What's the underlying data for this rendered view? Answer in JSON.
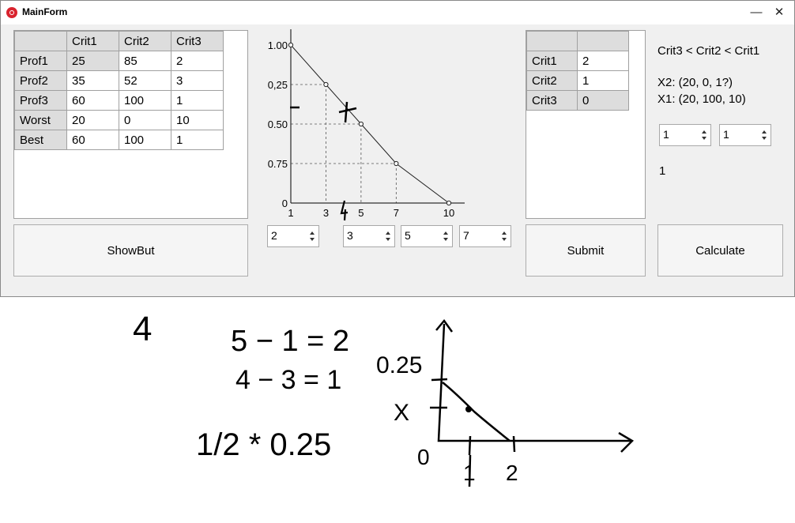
{
  "window": {
    "title": "MainForm",
    "minimize_glyph": "—",
    "close_glyph": "✕",
    "icon": "app-icon",
    "icon_color": "#d9232e"
  },
  "left_table": {
    "columns": [
      "",
      "Crit1",
      "Crit2",
      "Crit3"
    ],
    "rows": [
      [
        "Prof1",
        "25",
        "85",
        "2"
      ],
      [
        "Prof2",
        "35",
        "52",
        "3"
      ],
      [
        "Prof3",
        "60",
        "100",
        "1"
      ],
      [
        "Worst",
        "20",
        "0",
        "10"
      ],
      [
        "Best",
        "60",
        "100",
        "1"
      ]
    ]
  },
  "show_button": {
    "label": "ShowBut"
  },
  "chart_data": {
    "type": "line",
    "x": [
      1,
      3,
      5,
      7,
      10
    ],
    "y": [
      1.0,
      0.75,
      0.5,
      0.25,
      0
    ],
    "x_tick_labels": [
      "1",
      "3",
      "5",
      "7",
      "10"
    ],
    "y_tick_labels": [
      "1.00",
      "0,25",
      "0.50",
      "0.75",
      "0"
    ],
    "guide_lines": "dashed",
    "handwritten_marks": [
      "4"
    ]
  },
  "chart_spinners": [
    "2",
    "3",
    "5",
    "7"
  ],
  "right_table": {
    "rows": [
      [
        "Crit1",
        "2"
      ],
      [
        "Crit2",
        "1"
      ],
      [
        "Crit3",
        "0"
      ]
    ]
  },
  "submit_button": {
    "label": "Submit"
  },
  "results": {
    "order": "Crit3 < Crit2 < Crit1",
    "x2": "X2: (20, 0, 1?)",
    "x1": "X1: (20, 100, 10)",
    "spinner_a": "1",
    "spinner_b": "1",
    "output": "1"
  },
  "calculate_button": {
    "label": "Calculate"
  },
  "handwriting": {
    "number": "4",
    "eq1": "5 − 1 = 2",
    "eq2": "4 − 3 = 1",
    "product": "1/2 * 0.25",
    "y_label": "0.25",
    "x_label": "X",
    "origin": "0",
    "tick1": "1",
    "tick2": "2"
  }
}
